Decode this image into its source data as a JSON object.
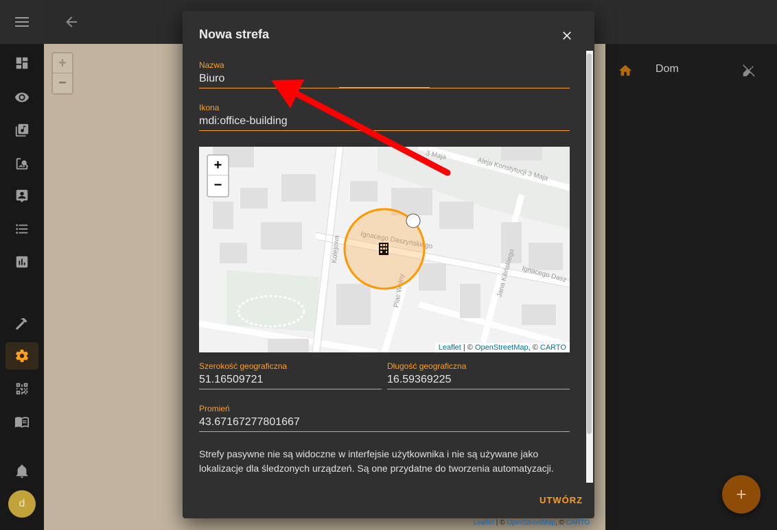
{
  "sidebar": {
    "menu_icon": "hamburger-icon",
    "items": [
      {
        "icon": "dashboard-icon"
      },
      {
        "icon": "eye-icon"
      },
      {
        "icon": "media-icon"
      },
      {
        "icon": "image-search-icon"
      },
      {
        "icon": "account-box-icon"
      },
      {
        "icon": "list-icon"
      },
      {
        "icon": "chart-icon"
      },
      {
        "icon": "hammer-icon"
      },
      {
        "icon": "cog-icon"
      },
      {
        "icon": "qrcode-icon"
      },
      {
        "icon": "book-icon"
      }
    ],
    "notifications_icon": "bell-icon",
    "avatar_letter": "d"
  },
  "header": {
    "back_icon": "arrow-left-icon"
  },
  "background_map": {
    "attribution": {
      "leaflet": "Leaflet",
      "sep1": " | © ",
      "osm": "OpenStreetMap",
      "sep2": ", © ",
      "carto": "CARTO"
    }
  },
  "zones_panel": {
    "home_zone_name": "Dom"
  },
  "dialog": {
    "title": "Nowa strefa",
    "name_field": {
      "label": "Nazwa",
      "value": "Biuro"
    },
    "icon_field": {
      "label": "Ikona",
      "value": "mdi:office-building"
    },
    "map": {
      "zoom_in": "+",
      "zoom_out": "−",
      "streets": [
        "3 Maja",
        "Aleja Konstytucji 3 Maja",
        "Kolejowa",
        "Ignacego Daszyńskiego",
        "Plac Wolny",
        "Jana Kilińskiego",
        "Ignacego Dasz"
      ],
      "attribution": {
        "leaflet": "Leaflet",
        "sep1": " | © ",
        "osm": "OpenStreetMap",
        "sep2": ", © ",
        "carto": "CARTO"
      }
    },
    "latitude_field": {
      "label": "Szerokość geograficzna",
      "value": "51.16509721"
    },
    "longitude_field": {
      "label": "Długość geograficzna",
      "value": "16.59369225"
    },
    "radius_field": {
      "label": "Promień",
      "value": "43.67167277801667"
    },
    "description": "Strefy pasywne nie są widoczne w interfejsie użytkownika i nie są używane jako lokalizacje dla śledzonych urządzeń. Są one przydatne do tworzenia automatyzacji.",
    "create_button": "UTWÓRZ"
  },
  "colors": {
    "accent": "#ff9f1a",
    "annotation_arrow": "#ff0000"
  }
}
